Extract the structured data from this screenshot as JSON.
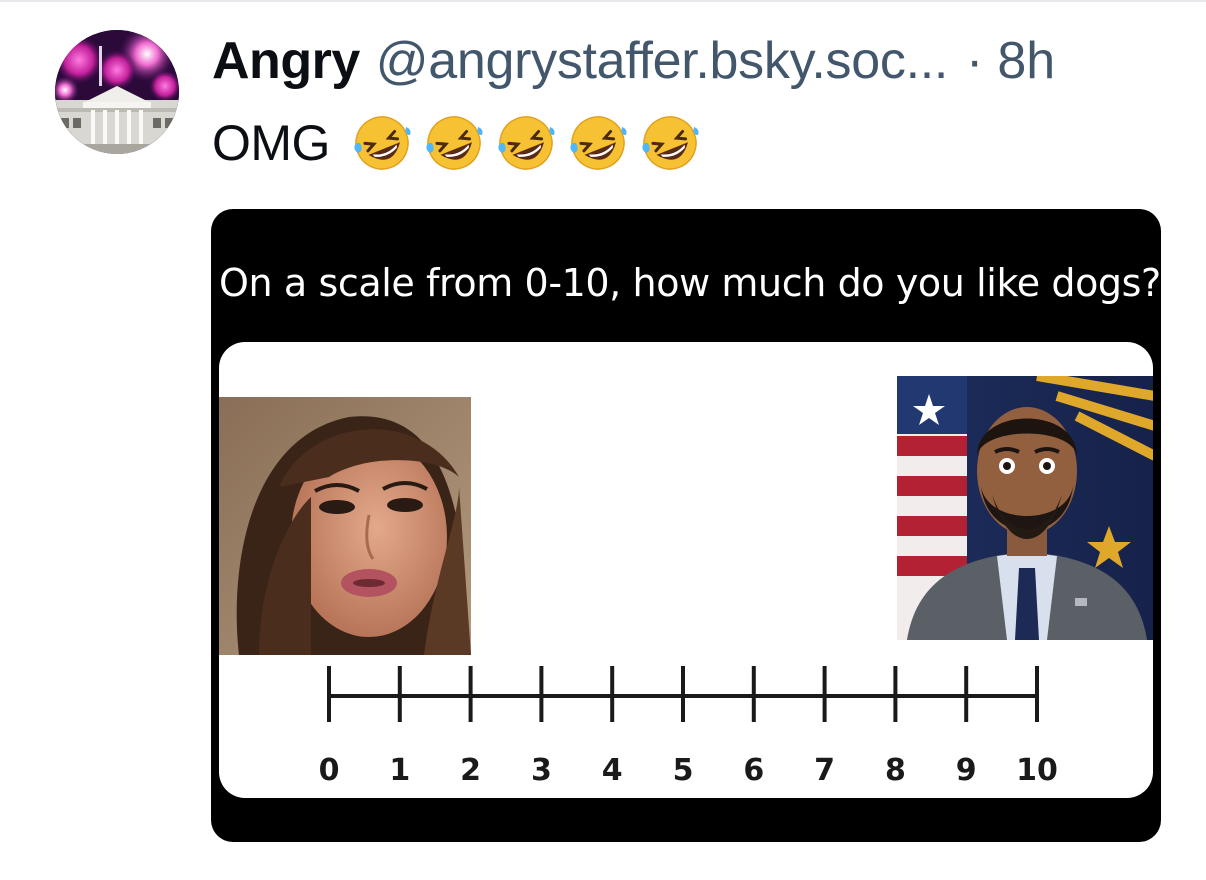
{
  "post": {
    "display_name": "Angry",
    "handle": "@angrystaffer.bsky.soc...",
    "separator": "·",
    "timestamp": "8h",
    "text": "OMG",
    "emojis": [
      "rolling-on-floor-laughing",
      "rolling-on-floor-laughing",
      "rolling-on-floor-laughing",
      "rolling-on-floor-laughing",
      "rolling-on-floor-laughing"
    ]
  },
  "embed": {
    "question": "On a scale from 0-10, how much do you like dogs?",
    "scale_ticks": [
      "0",
      "1",
      "2",
      "3",
      "4",
      "5",
      "6",
      "7",
      "8",
      "9",
      "10"
    ]
  },
  "colors": {
    "name": "#0b0f14",
    "meta": "#42576c",
    "embed_bg": "#000000",
    "panel_bg": "#ffffff"
  }
}
